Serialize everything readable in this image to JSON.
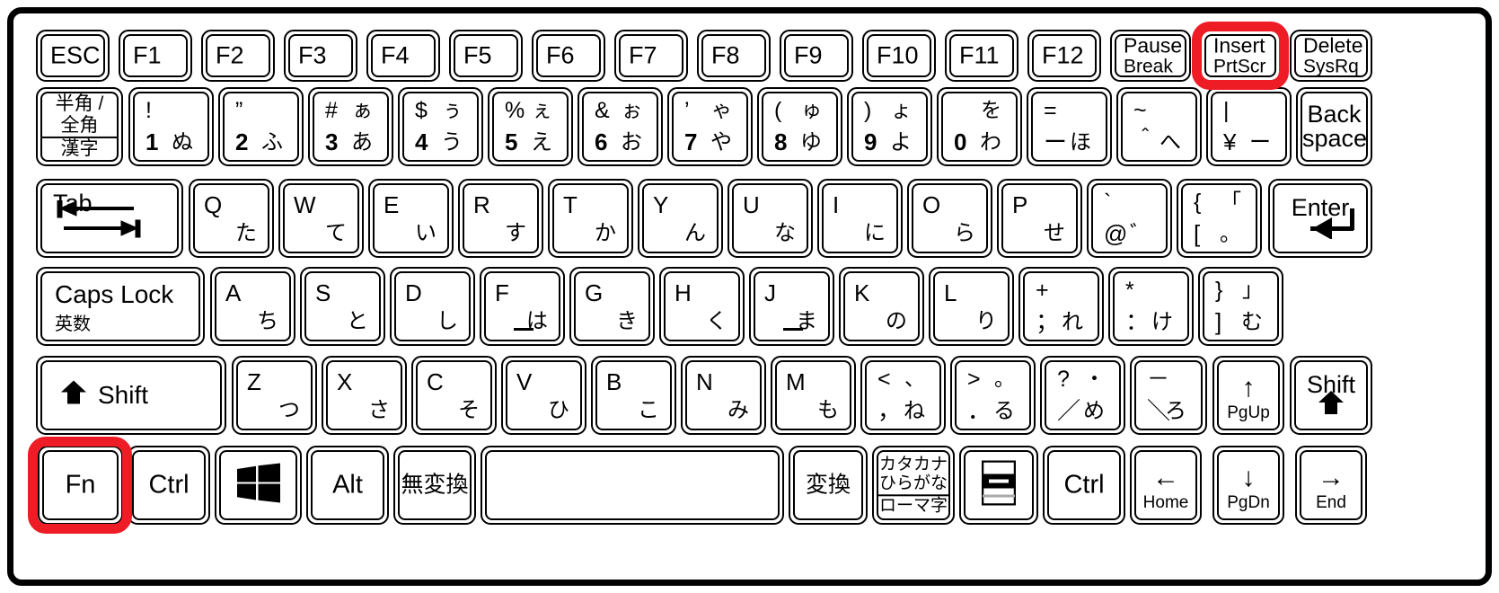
{
  "keyboard": {
    "title": "Japanese JIS laptop keyboard layout",
    "highlight_color": "#ee1c25",
    "highlighted_keys": [
      "insert-prtscr",
      "fn"
    ],
    "rows": {
      "function_row": [
        {
          "name": "esc",
          "label": "ESC"
        },
        {
          "name": "f1",
          "label": "F1"
        },
        {
          "name": "f2",
          "label": "F2"
        },
        {
          "name": "f3",
          "label": "F3"
        },
        {
          "name": "f4",
          "label": "F4"
        },
        {
          "name": "f5",
          "label": "F5"
        },
        {
          "name": "f6",
          "label": "F6"
        },
        {
          "name": "f7",
          "label": "F7"
        },
        {
          "name": "f8",
          "label": "F8"
        },
        {
          "name": "f9",
          "label": "F9"
        },
        {
          "name": "f10",
          "label": "F10"
        },
        {
          "name": "f11",
          "label": "F11"
        },
        {
          "name": "f12",
          "label": "F12"
        },
        {
          "name": "pause-break",
          "line1": "Pause",
          "line2": "Break"
        },
        {
          "name": "insert-prtscr",
          "line1": "Insert",
          "line2": "PrtScr"
        },
        {
          "name": "delete-sysrq",
          "line1": "Delete",
          "line2": "SysRq"
        }
      ],
      "number_row": [
        {
          "name": "hankaku-zenkaku",
          "line1": "半角 /",
          "line2": "全角",
          "line3": "漢字"
        },
        {
          "name": "digit-1",
          "tl": "!",
          "tr": "",
          "bl": "1",
          "br": "ぬ"
        },
        {
          "name": "digit-2",
          "tl": "”",
          "tr": "",
          "bl": "2",
          "br": "ふ"
        },
        {
          "name": "digit-3",
          "tl": "#",
          "tr": "ぁ",
          "bl": "3",
          "br": "あ"
        },
        {
          "name": "digit-4",
          "tl": "$",
          "tr": "ぅ",
          "bl": "4",
          "br": "う"
        },
        {
          "name": "digit-5",
          "tl": "%",
          "tr": "ぇ",
          "bl": "5",
          "br": "え"
        },
        {
          "name": "digit-6",
          "tl": "&",
          "tr": "ぉ",
          "bl": "6",
          "br": "お"
        },
        {
          "name": "digit-7",
          "tl": "’",
          "tr": "ゃ",
          "bl": "7",
          "br": "や"
        },
        {
          "name": "digit-8",
          "tl": "(",
          "tr": "ゅ",
          "bl": "8",
          "br": "ゆ"
        },
        {
          "name": "digit-9",
          "tl": ")",
          "tr": "ょ",
          "bl": "9",
          "br": "よ"
        },
        {
          "name": "digit-0",
          "tl": "",
          "tr": "を",
          "bl": "0",
          "br": "わ"
        },
        {
          "name": "minus",
          "tl": "=",
          "tr": "",
          "bl": "ー",
          "br": "ほ"
        },
        {
          "name": "caret",
          "tl": "~",
          "tr": "",
          "bl": "＾",
          "br": "へ"
        },
        {
          "name": "yen",
          "tl": "|",
          "tr": "",
          "bl": "¥",
          "br": "ー"
        },
        {
          "name": "backspace",
          "line1": "Back",
          "line2": "space"
        }
      ],
      "tab_row": [
        {
          "name": "tab",
          "label": "Tab",
          "icon": "tab-arrows-icon"
        },
        {
          "name": "key-q",
          "alpha": "Q",
          "kana": "た"
        },
        {
          "name": "key-w",
          "alpha": "W",
          "kana": "て"
        },
        {
          "name": "key-e",
          "alpha": "E",
          "kana": "い"
        },
        {
          "name": "key-r",
          "alpha": "R",
          "kana": "す"
        },
        {
          "name": "key-t",
          "alpha": "T",
          "kana": "か"
        },
        {
          "name": "key-y",
          "alpha": "Y",
          "kana": "ん"
        },
        {
          "name": "key-u",
          "alpha": "U",
          "kana": "な"
        },
        {
          "name": "key-i",
          "alpha": "I",
          "kana": "に"
        },
        {
          "name": "key-o",
          "alpha": "O",
          "kana": "ら"
        },
        {
          "name": "key-p",
          "alpha": "P",
          "kana": "せ"
        },
        {
          "name": "at-key",
          "tl": "`",
          "bl": "@",
          "br": "゛"
        },
        {
          "name": "bracket-left",
          "tl": "{",
          "tr": "「",
          "bl": "[",
          "br": "。"
        },
        {
          "name": "enter",
          "label": "Enter",
          "icon": "return-arrow-icon"
        }
      ],
      "home_row": [
        {
          "name": "caps-lock",
          "line1": "Caps Lock",
          "line2": "英数"
        },
        {
          "name": "key-a",
          "alpha": "A",
          "kana": "ち"
        },
        {
          "name": "key-s",
          "alpha": "S",
          "kana": "と"
        },
        {
          "name": "key-d",
          "alpha": "D",
          "kana": "し"
        },
        {
          "name": "key-f",
          "alpha": "F",
          "kana": "は",
          "homing": true
        },
        {
          "name": "key-g",
          "alpha": "G",
          "kana": "き"
        },
        {
          "name": "key-h",
          "alpha": "H",
          "kana": "く"
        },
        {
          "name": "key-j",
          "alpha": "J",
          "kana": "ま",
          "homing": true
        },
        {
          "name": "key-k",
          "alpha": "K",
          "kana": "の"
        },
        {
          "name": "key-l",
          "alpha": "L",
          "kana": "り"
        },
        {
          "name": "semicolon",
          "tl": "+",
          "bl": "；",
          "br": "れ"
        },
        {
          "name": "colon",
          "tl": "*",
          "bl": "：",
          "br": "け"
        },
        {
          "name": "bracket-right",
          "tl": "}",
          "tr": "」",
          "bl": "]",
          "br": "む"
        }
      ],
      "shift_row": [
        {
          "name": "shift-left",
          "label": "Shift",
          "icon": "shift-arrow-icon"
        },
        {
          "name": "key-z",
          "alpha": "Z",
          "kana": "つ"
        },
        {
          "name": "key-x",
          "alpha": "X",
          "kana": "さ"
        },
        {
          "name": "key-c",
          "alpha": "C",
          "kana": "そ"
        },
        {
          "name": "key-v",
          "alpha": "V",
          "kana": "ひ"
        },
        {
          "name": "key-b",
          "alpha": "B",
          "kana": "こ"
        },
        {
          "name": "key-n",
          "alpha": "N",
          "kana": "み"
        },
        {
          "name": "key-m",
          "alpha": "M",
          "kana": "も"
        },
        {
          "name": "comma",
          "tl": "<",
          "tr": "、",
          "bl": "，",
          "br": "ね"
        },
        {
          "name": "period",
          "tl": ">",
          "tr": "。",
          "bl": "．",
          "br": "る"
        },
        {
          "name": "slash",
          "tl": "?",
          "tr": "・",
          "bl": "／",
          "br": "め"
        },
        {
          "name": "backslash-ro",
          "tl": "－",
          "bl": "＼",
          "br": "ろ"
        },
        {
          "name": "arrow-up",
          "glyph": "↑",
          "word": "PgUp"
        },
        {
          "name": "shift-right",
          "label": "Shift",
          "icon": "shift-arrow-icon"
        }
      ],
      "bottom_row": [
        {
          "name": "fn",
          "label": "Fn"
        },
        {
          "name": "ctrl-left",
          "label": "Ctrl"
        },
        {
          "name": "windows",
          "icon": "windows-logo-icon"
        },
        {
          "name": "alt",
          "label": "Alt"
        },
        {
          "name": "muhenkan",
          "label": "無変換"
        },
        {
          "name": "space",
          "label": ""
        },
        {
          "name": "henkan",
          "label": "変換"
        },
        {
          "name": "katakana-hiragana-romaji",
          "line1": "カタカナ",
          "line2": "ひらがな",
          "line3": "ローマ字"
        },
        {
          "name": "menu",
          "icon": "context-menu-icon"
        },
        {
          "name": "ctrl-right",
          "label": "Ctrl"
        },
        {
          "name": "arrow-left",
          "glyph": "←",
          "word": "Home"
        },
        {
          "name": "arrow-down",
          "glyph": "↓",
          "word": "PgDn"
        },
        {
          "name": "arrow-right",
          "glyph": "→",
          "word": "End"
        }
      ]
    }
  }
}
